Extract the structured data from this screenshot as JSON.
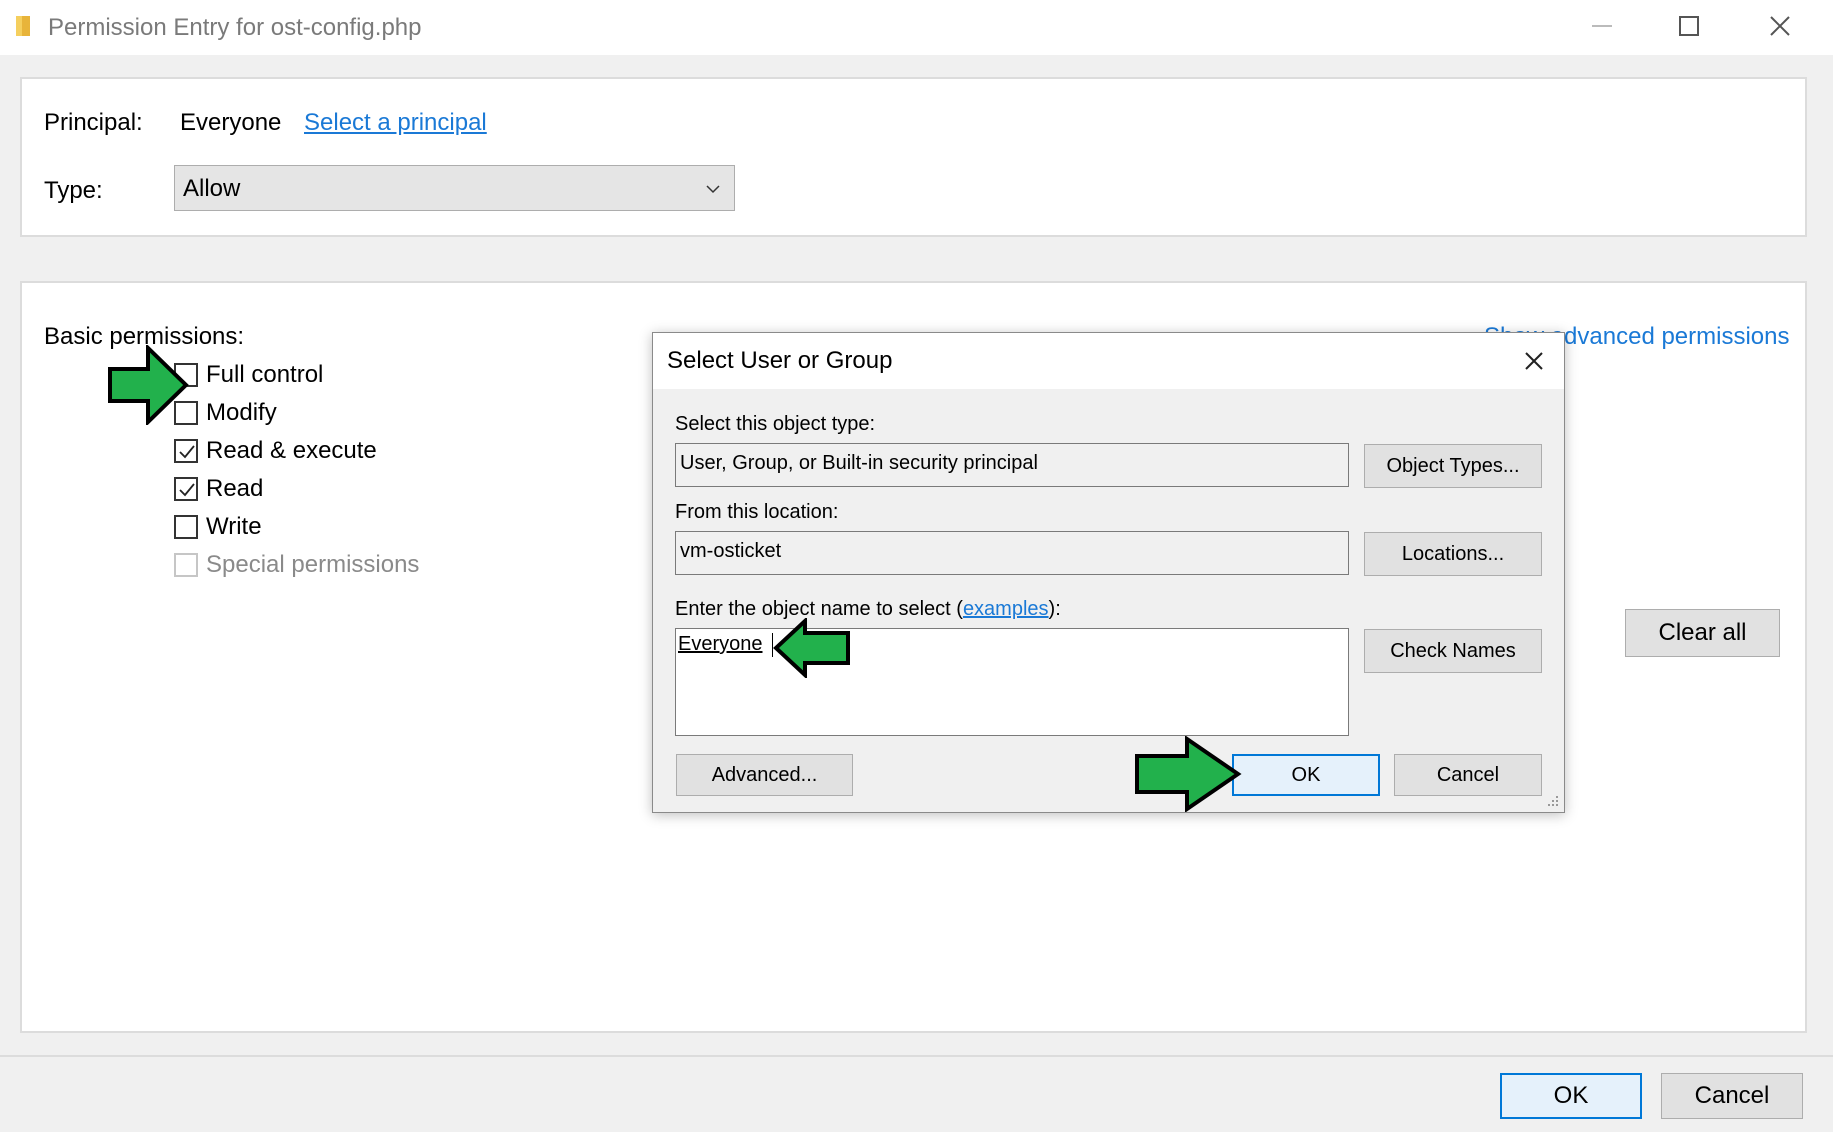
{
  "window": {
    "title": "Permission Entry for ost-config.php",
    "minimize_icon": "minimize-icon",
    "maximize_icon": "maximize-icon",
    "close_icon": "close-icon"
  },
  "principal": {
    "label": "Principal:",
    "value": "Everyone",
    "link": "Select a principal"
  },
  "type": {
    "label": "Type:",
    "selected": "Allow"
  },
  "permissions": {
    "heading": "Basic permissions:",
    "show_advanced": "Show advanced permissions",
    "items": [
      {
        "label": "Full control",
        "checked": false,
        "disabled": false
      },
      {
        "label": "Modify",
        "checked": false,
        "disabled": false
      },
      {
        "label": "Read & execute",
        "checked": true,
        "disabled": false
      },
      {
        "label": "Read",
        "checked": true,
        "disabled": false
      },
      {
        "label": "Write",
        "checked": false,
        "disabled": false
      },
      {
        "label": "Special permissions",
        "checked": false,
        "disabled": true
      }
    ],
    "clear_all": "Clear all"
  },
  "footer": {
    "ok": "OK",
    "cancel": "Cancel"
  },
  "dialog": {
    "title": "Select User or Group",
    "object_type_label": "Select this object type:",
    "object_type_value": "User, Group, or Built-in security principal",
    "object_types_button": "Object Types...",
    "location_label": "From this location:",
    "location_value": "vm-osticket",
    "locations_button": "Locations...",
    "enter_name_prefix": "Enter the object name to select (",
    "examples_link": "examples",
    "enter_name_suffix": "):",
    "name_value": "Everyone",
    "check_names_button": "Check Names",
    "advanced_button": "Advanced...",
    "ok_button": "OK",
    "cancel_button": "Cancel"
  },
  "colors": {
    "link": "#1a79d6",
    "annotation_arrow": "#22b14c",
    "focus_border": "#0078d7"
  }
}
